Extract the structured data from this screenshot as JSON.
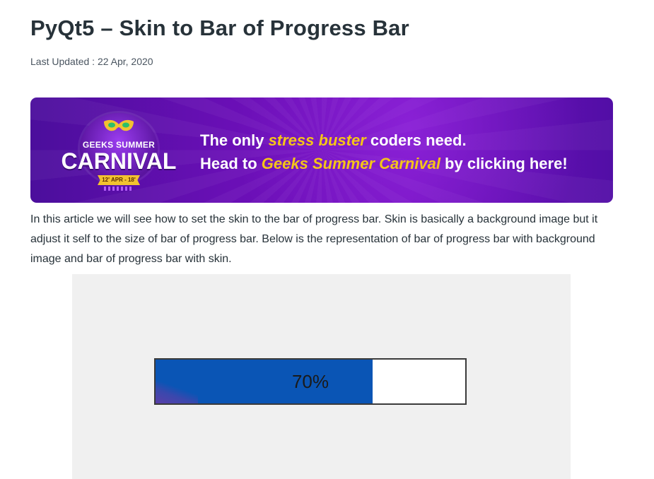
{
  "article": {
    "title": "PyQt5 – Skin to Bar of Progress Bar",
    "last_updated": "Last Updated : 22 Apr, 2020",
    "intro": "In this article we will see how to set the skin to the bar of progress bar. Skin is basically a background image but it adjust it self to the size of bar of progress bar. Below is the representation of bar of progress bar with background image and bar of progress bar with skin."
  },
  "banner": {
    "badge_top": "GEEKS SUMMER",
    "badge_main": "CARNIVAL",
    "badge_dates": "12' APR - 18' APR",
    "line1_a": "The only ",
    "line1_hl": "stress buster",
    "line1_b": " coders need.",
    "line2_a": "Head to ",
    "line2_hl": "Geeks Summer Carnival",
    "line2_b": " by clicking here!",
    "colors": {
      "accent": "#f5c518",
      "background": "#6a0fb6"
    }
  },
  "figure": {
    "progress_value": 70,
    "progress_label": "70%",
    "chunk_color": "#0a55b5",
    "background": "#f0f0f0"
  }
}
